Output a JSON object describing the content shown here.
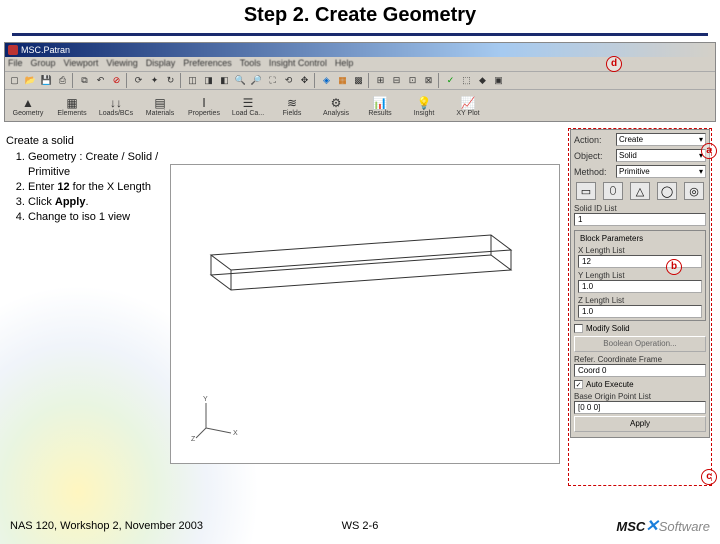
{
  "slide": {
    "title": "Step 2. Create Geometry",
    "footer_left": "NAS 120, Workshop 2, November 2003",
    "footer_center": "WS 2-6"
  },
  "app": {
    "title": "MSC.Patran",
    "menu": [
      "File",
      "Group",
      "Viewport",
      "Viewing",
      "Display",
      "Preferences",
      "Tools",
      "Insight Control",
      "Help"
    ],
    "toolbar": {
      "geometry": "Geometry",
      "elements": "Elements",
      "loads": "Loads/BCs",
      "materials": "Materials",
      "properties": "Properties",
      "loadca": "Load Ca...",
      "fields": "Fields",
      "analysis": "Analysis",
      "results": "Results",
      "insight": "Insight",
      "xyplot": "XY Plot"
    }
  },
  "instructions": {
    "header": "Create a solid",
    "step1_a": "Geometry : Create / Solid / Primitive",
    "step2_a": "Enter ",
    "step2_b": "12",
    "step2_c": " for the X Length",
    "step3_a": "Click ",
    "step3_b": "Apply",
    "step3_c": ".",
    "step4": "Change to iso 1 view"
  },
  "panel": {
    "action_label": "Action:",
    "action_value": "Create",
    "object_label": "Object:",
    "object_value": "Solid",
    "method_label": "Method:",
    "method_value": "Primitive",
    "solid_id_label": "Solid ID List",
    "solid_id_value": "1",
    "block_params": "Block Parameters",
    "x_len_label": "X Length List",
    "x_len_value": "12",
    "y_len_label": "Y Length List",
    "y_len_value": "1.0",
    "z_len_label": "Z Length List",
    "z_len_value": "1.0",
    "modify_solid": "Modify Solid",
    "boolean_btn": "Boolean Operation...",
    "refer_label": "Refer. Coordinate Frame",
    "refer_value": "Coord 0",
    "auto_exec": "Auto Execute",
    "origin_label": "Base Origin Point List",
    "origin_value": "[0 0 0]",
    "apply": "Apply"
  },
  "annotations": {
    "a": "a",
    "b": "b",
    "c": "c",
    "d": "d"
  },
  "logo": {
    "msc": "MSC",
    "sw": "Software"
  }
}
